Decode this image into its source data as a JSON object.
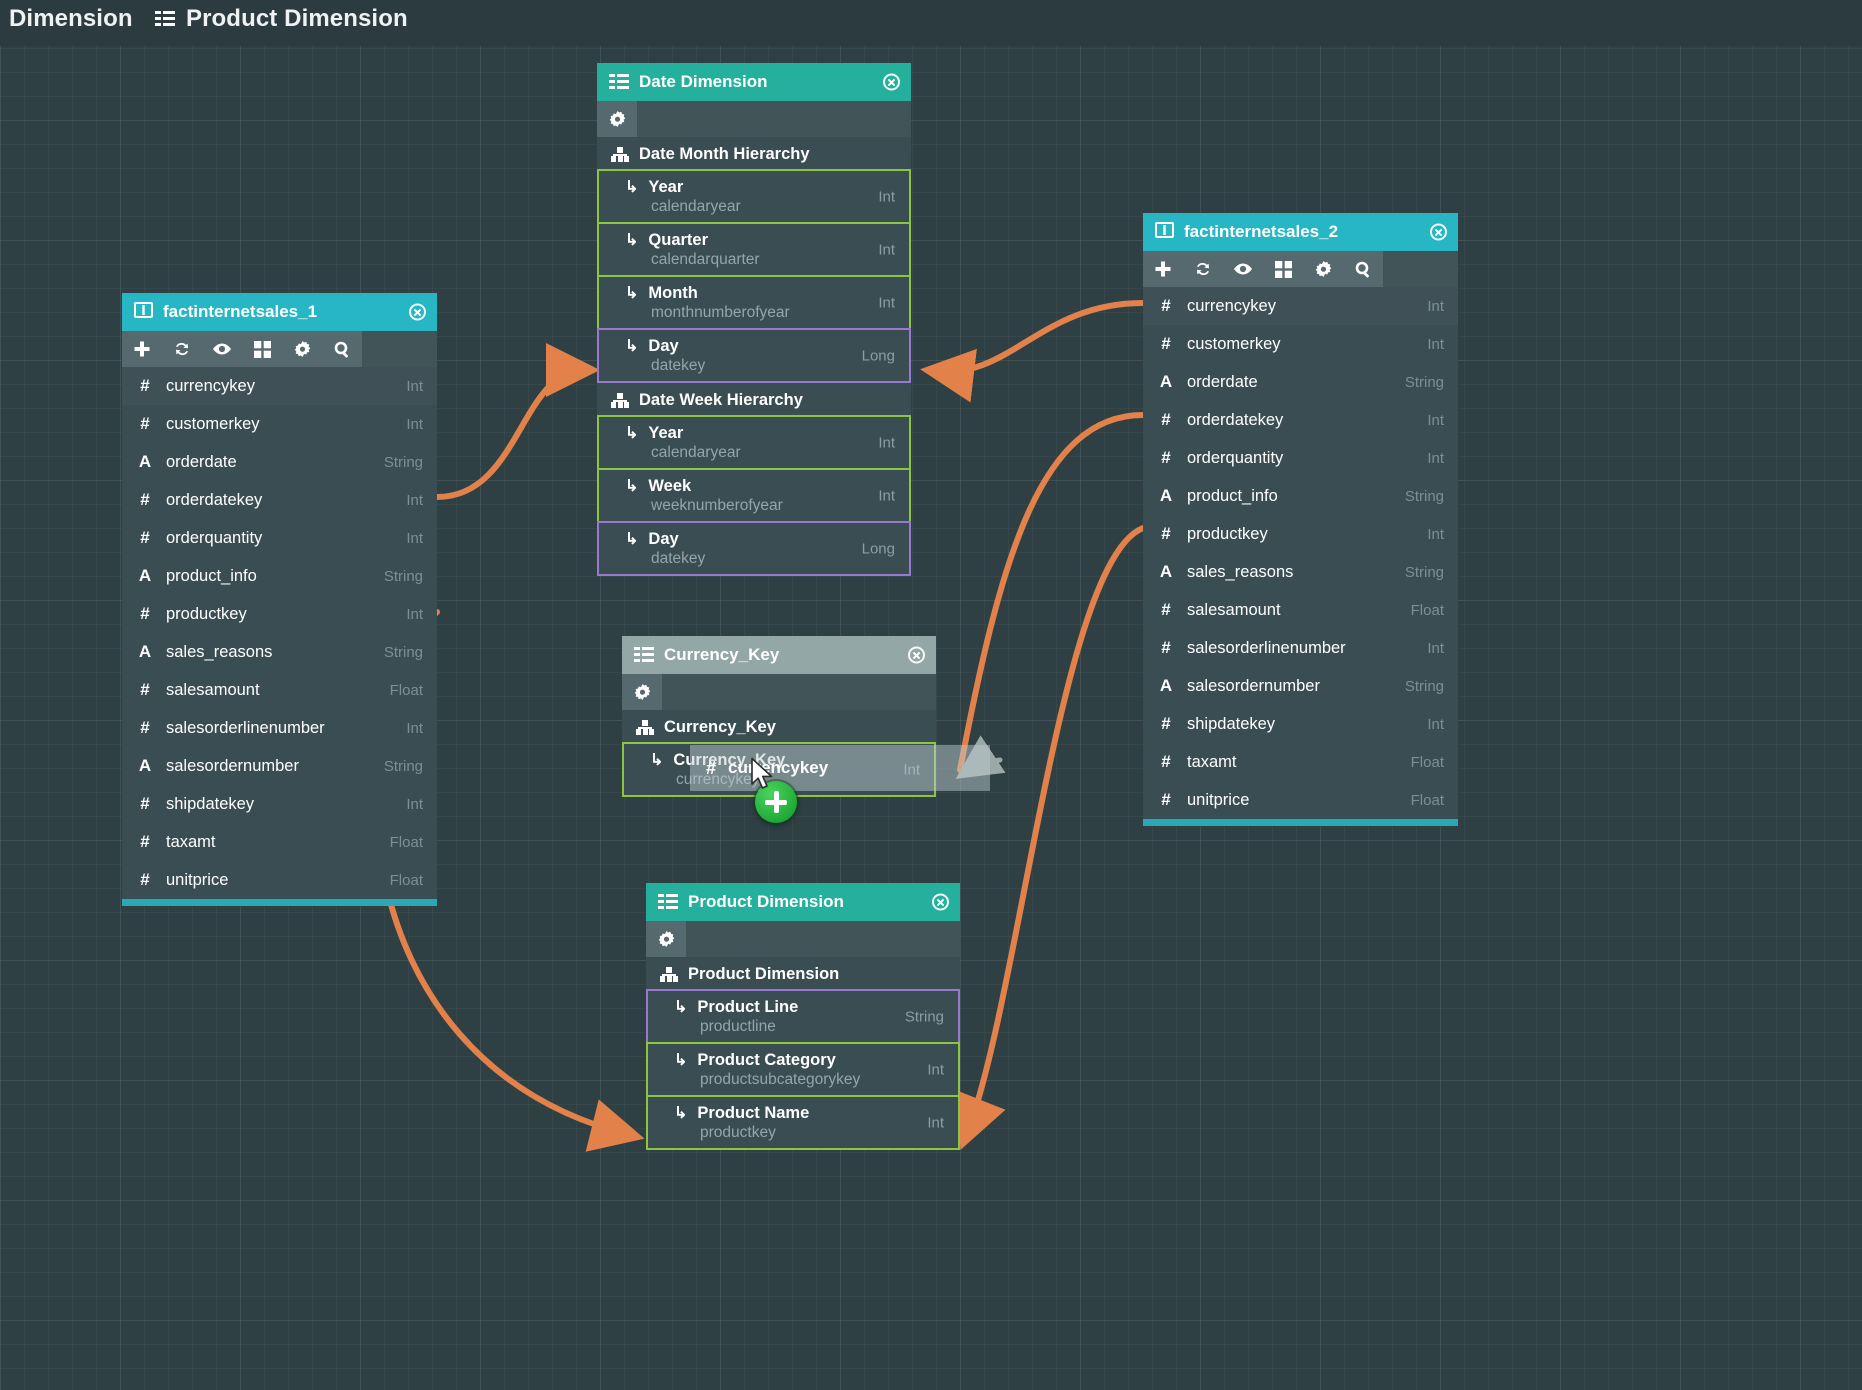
{
  "app": {
    "canvas_background": "#2e4044",
    "accent_teal": "#27b7c4",
    "accent_green": "#25b09d",
    "link_color": "#e2814a",
    "hierarchy_green": "#8cc63f",
    "hierarchy_purple": "#9a78cf"
  },
  "topbar": {
    "tabs": [
      {
        "label": "Dimension",
        "icon": "list-icon"
      },
      {
        "label": "Product Dimension",
        "icon": "list-icon"
      }
    ]
  },
  "cards": {
    "factinternetsales_1": {
      "title": "factinternetsales_1",
      "header_icon": "table-icon",
      "close_icon": "close-icon",
      "toolbar": [
        {
          "name": "add-button",
          "icon": "plus-icon"
        },
        {
          "name": "refresh-button",
          "icon": "refresh-icon"
        },
        {
          "name": "preview-button",
          "icon": "eye-icon"
        },
        {
          "name": "grid-button",
          "icon": "grid-icon"
        },
        {
          "name": "settings-button",
          "icon": "gear-icon"
        },
        {
          "name": "search-button",
          "icon": "search-icon"
        }
      ],
      "fields": [
        {
          "name": "currencykey",
          "type": "Int",
          "kind": "number"
        },
        {
          "name": "customerkey",
          "type": "Int",
          "kind": "number"
        },
        {
          "name": "orderdate",
          "type": "String",
          "kind": "text"
        },
        {
          "name": "orderdatekey",
          "type": "Int",
          "kind": "number"
        },
        {
          "name": "orderquantity",
          "type": "Int",
          "kind": "number"
        },
        {
          "name": "product_info",
          "type": "String",
          "kind": "text"
        },
        {
          "name": "productkey",
          "type": "Int",
          "kind": "number"
        },
        {
          "name": "sales_reasons",
          "type": "String",
          "kind": "text"
        },
        {
          "name": "salesamount",
          "type": "Float",
          "kind": "number"
        },
        {
          "name": "salesorderlinenumber",
          "type": "Int",
          "kind": "number"
        },
        {
          "name": "salesordernumber",
          "type": "String",
          "kind": "text"
        },
        {
          "name": "shipdatekey",
          "type": "Int",
          "kind": "number"
        },
        {
          "name": "taxamt",
          "type": "Float",
          "kind": "number"
        },
        {
          "name": "unitprice",
          "type": "Float",
          "kind": "number"
        }
      ]
    },
    "factinternetsales_2": {
      "title": "factinternetsales_2",
      "header_icon": "table-icon",
      "close_icon": "close-icon",
      "toolbar": [
        {
          "name": "add-button",
          "icon": "plus-icon"
        },
        {
          "name": "refresh-button",
          "icon": "refresh-icon"
        },
        {
          "name": "preview-button",
          "icon": "eye-icon"
        },
        {
          "name": "grid-button",
          "icon": "grid-icon"
        },
        {
          "name": "settings-button",
          "icon": "gear-icon"
        },
        {
          "name": "search-button",
          "icon": "search-icon"
        }
      ],
      "fields": [
        {
          "name": "currencykey",
          "type": "Int",
          "kind": "number"
        },
        {
          "name": "customerkey",
          "type": "Int",
          "kind": "number"
        },
        {
          "name": "orderdate",
          "type": "String",
          "kind": "text"
        },
        {
          "name": "orderdatekey",
          "type": "Int",
          "kind": "number"
        },
        {
          "name": "orderquantity",
          "type": "Int",
          "kind": "number"
        },
        {
          "name": "product_info",
          "type": "String",
          "kind": "text"
        },
        {
          "name": "productkey",
          "type": "Int",
          "kind": "number"
        },
        {
          "name": "sales_reasons",
          "type": "String",
          "kind": "text"
        },
        {
          "name": "salesamount",
          "type": "Float",
          "kind": "number"
        },
        {
          "name": "salesorderlinenumber",
          "type": "Int",
          "kind": "number"
        },
        {
          "name": "salesordernumber",
          "type": "String",
          "kind": "text"
        },
        {
          "name": "shipdatekey",
          "type": "Int",
          "kind": "number"
        },
        {
          "name": "taxamt",
          "type": "Float",
          "kind": "number"
        },
        {
          "name": "unitprice",
          "type": "Float",
          "kind": "number"
        }
      ]
    },
    "date_dimension": {
      "title": "Date Dimension",
      "header_icon": "list-icon",
      "close_icon": "close-icon",
      "toolbar": [
        {
          "name": "settings-button",
          "icon": "gear-icon"
        }
      ],
      "hierarchies": [
        {
          "name": "Date Month Hierarchy",
          "icon": "hierarchy-icon",
          "levels": [
            {
              "label": "Year",
              "column": "calendaryear",
              "type": "Int",
              "outline": "green"
            },
            {
              "label": "Quarter",
              "column": "calendarquarter",
              "type": "Int",
              "outline": "green"
            },
            {
              "label": "Month",
              "column": "monthnumberofyear",
              "type": "Int",
              "outline": "green"
            },
            {
              "label": "Day",
              "column": "datekey",
              "type": "Long",
              "outline": "purple"
            }
          ]
        },
        {
          "name": "Date Week Hierarchy",
          "icon": "hierarchy-icon",
          "levels": [
            {
              "label": "Year",
              "column": "calendaryear",
              "type": "Int",
              "outline": "green"
            },
            {
              "label": "Week",
              "column": "weeknumberofyear",
              "type": "Int",
              "outline": "green"
            },
            {
              "label": "Day",
              "column": "datekey",
              "type": "Long",
              "outline": "purple"
            }
          ]
        }
      ]
    },
    "currency_key": {
      "title": "Currency_Key",
      "header_icon": "list-icon",
      "close_icon": "close-icon",
      "toolbar": [
        {
          "name": "settings-button",
          "icon": "gear-icon"
        }
      ],
      "hierarchies": [
        {
          "name": "Currency_Key",
          "icon": "hierarchy-icon",
          "levels": [
            {
              "label": "Currency_Key",
              "column": "currencykey",
              "type": "Int",
              "outline": "green"
            }
          ]
        }
      ]
    },
    "product_dimension": {
      "title": "Product Dimension",
      "header_icon": "list-icon",
      "close_icon": "close-icon",
      "toolbar": [
        {
          "name": "settings-button",
          "icon": "gear-icon"
        }
      ],
      "hierarchies": [
        {
          "name": "Product Dimension",
          "icon": "hierarchy-icon",
          "levels": [
            {
              "label": "Product Line",
              "column": "productline",
              "type": "String",
              "outline": "purple"
            },
            {
              "label": "Product Category",
              "column": "productsubcategorykey",
              "type": "Int",
              "outline": "green"
            },
            {
              "label": "Product Name",
              "column": "productkey",
              "type": "Int",
              "outline": "green"
            }
          ]
        }
      ]
    }
  },
  "drag": {
    "ghost_label": "currencykey",
    "ghost_icon": "number-icon",
    "badge_icon": "plus-badge-icon",
    "cursor_icon": "arrow-cursor-icon"
  }
}
